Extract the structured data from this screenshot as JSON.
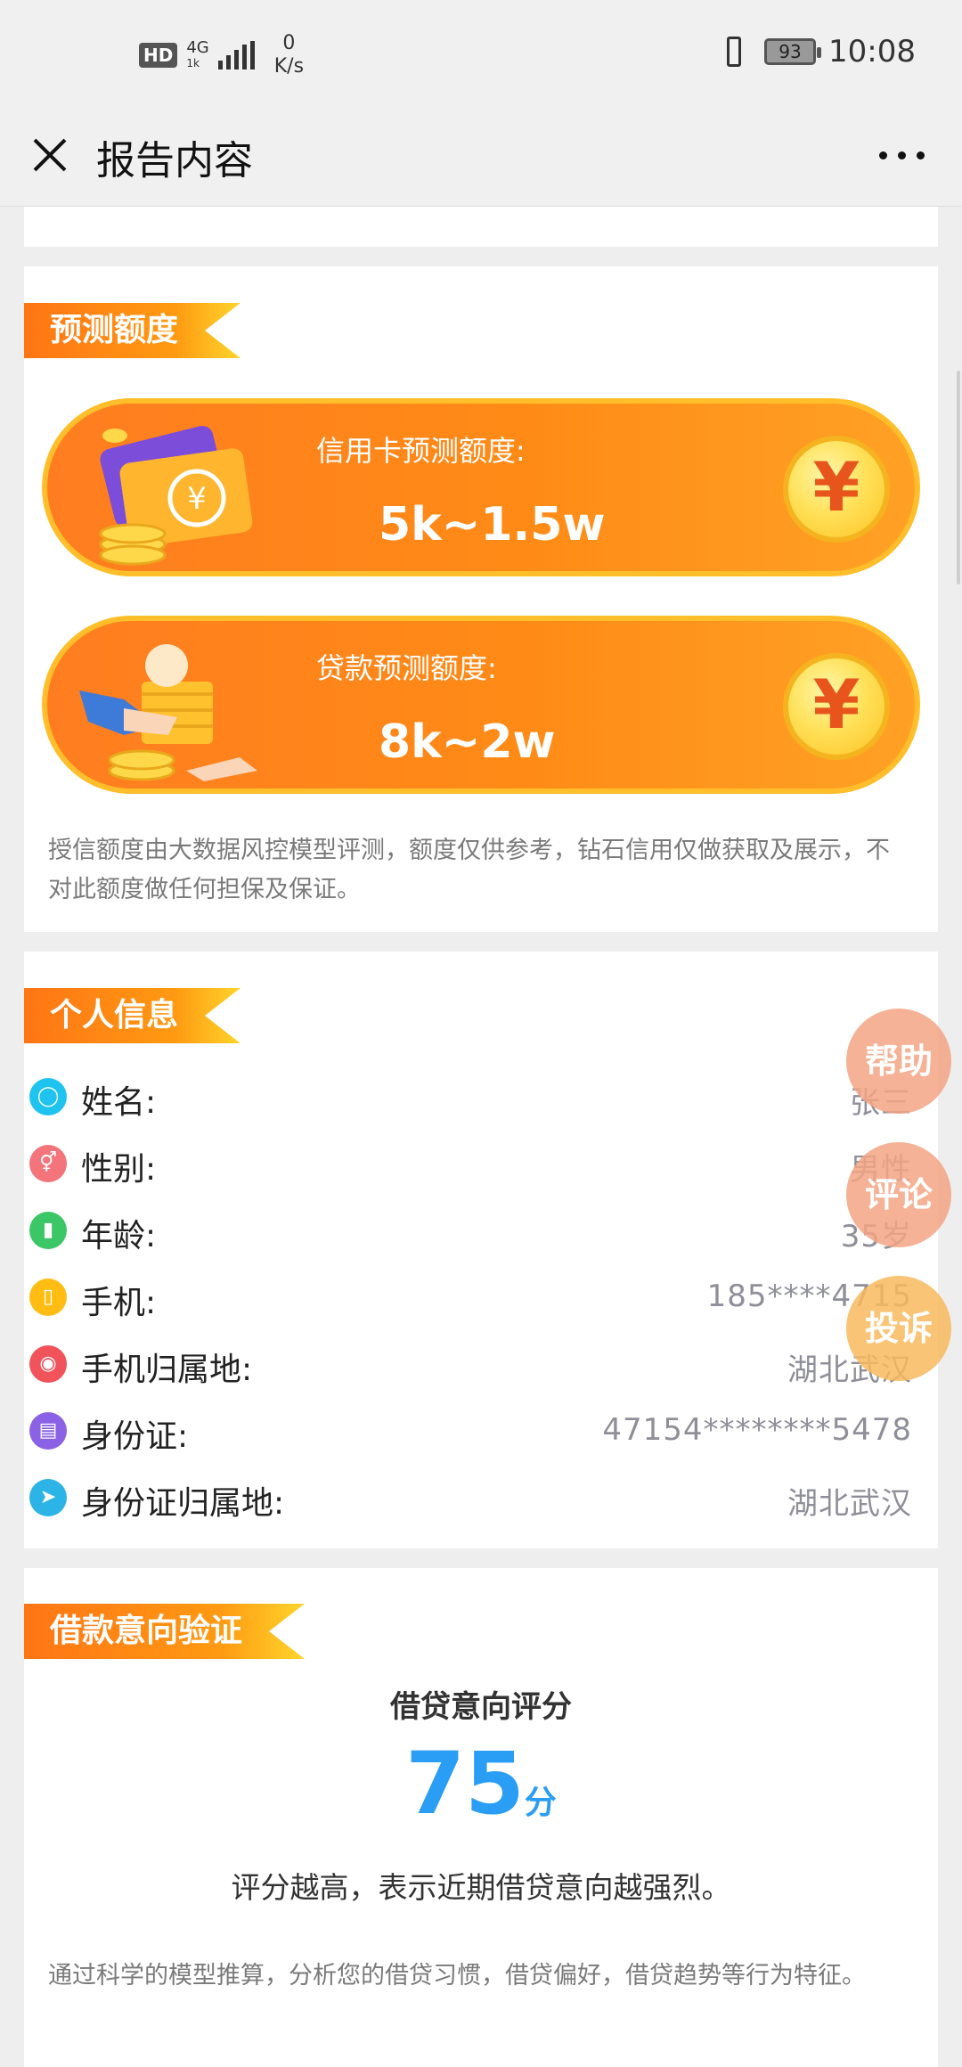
{
  "status_bar": {
    "hd": "HD",
    "network": "4G",
    "network_sub": "1k",
    "speed_value": "0",
    "speed_unit": "K/s",
    "battery": "93",
    "time": "10:08"
  },
  "nav": {
    "title": "报告内容"
  },
  "predict": {
    "section_title": "预测额度",
    "credit_card": {
      "label": "信用卡预测额度:",
      "amount": "5k~1.5w"
    },
    "loan": {
      "label": "贷款预测额度:",
      "amount": "8k~2w"
    },
    "coin_symbol": "¥",
    "disclaimer": "授信额度由大数据风控模型评测，额度仅供参考，钻石信用仅做获取及展示，不对此额度做任何担保及保证。"
  },
  "personal": {
    "section_title": "个人信息",
    "rows": [
      {
        "label": "姓名:",
        "value": "张三",
        "icon": "user-icon"
      },
      {
        "label": "性别:",
        "value": "男性",
        "icon": "gender-icon"
      },
      {
        "label": "年龄:",
        "value": "35岁",
        "icon": "age-chart-icon"
      },
      {
        "label": "手机:",
        "value": "185****4715",
        "icon": "phone-icon"
      },
      {
        "label": "手机归属地:",
        "value": "湖北武汉",
        "icon": "location-phone-icon"
      },
      {
        "label": "身份证:",
        "value": "47154********5478",
        "icon": "id-card-icon"
      },
      {
        "label": "身份证归属地:",
        "value": "湖北武汉",
        "icon": "location-pointer-icon"
      }
    ]
  },
  "float_buttons": {
    "help": "帮助",
    "review": "评论",
    "complain": "投诉"
  },
  "loan_intent": {
    "section_title": "借款意向验证",
    "score_title": "借贷意向评分",
    "score": "75",
    "score_unit": "分",
    "score_desc": "评分越高，表示近期借贷意向越强烈。",
    "note": "通过科学的模型推算，分析您的借贷习惯，借贷偏好，借贷趋势等行为特征。"
  },
  "colors": {
    "accent_orange": "#ff8b16",
    "score_blue": "#2a9df4"
  }
}
